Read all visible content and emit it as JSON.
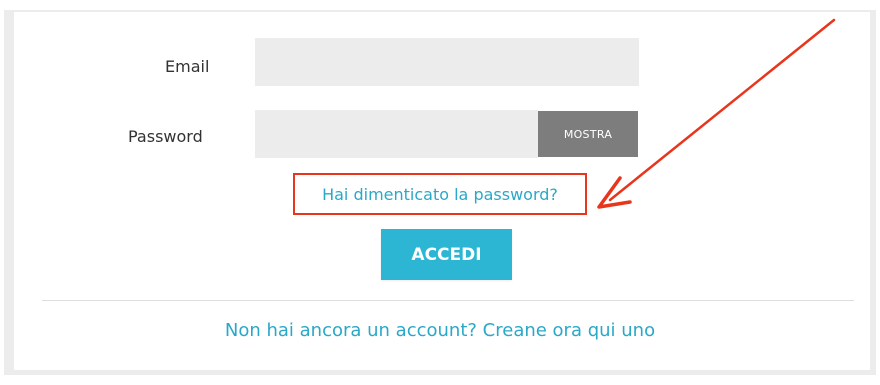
{
  "form": {
    "email_label": "Email",
    "email_value": "",
    "password_label": "Password",
    "password_value": "",
    "show_password_button": "MOSTRA",
    "forgot_password_link": "Hai dimenticato la password?",
    "login_button": "ACCEDI",
    "signup_link": "Non hai ancora un account? Creane ora qui uno"
  },
  "annotation": {
    "highlight_color": "#e8361c",
    "arrow_target": "forgot_password_link"
  },
  "colors": {
    "accent": "#2cb6d3",
    "link": "#2aa8c8",
    "field_background": "#ececec",
    "show_button_background": "#7d7d7d"
  }
}
